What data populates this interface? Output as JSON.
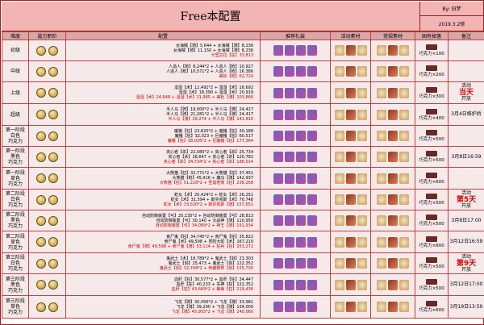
{
  "header": {
    "title": "Free本配置",
    "author": "By: 旧梦",
    "date": "2019.3.2修"
  },
  "columns": [
    "难度",
    "敌方职阶",
    "配置",
    "推荐礼装",
    "活动素材",
    "常规素材",
    "固有掉落",
    "备注"
  ],
  "rows": [
    {
      "difficulty": "初级",
      "config": [
        "女海賊【骑】5,644 + 女海賊【骑】8,236",
        "女海賊【骑】11,150 + 女海賊【骑】8,236",
        "卡里古拉【狂】33,813"
      ],
      "drop": "巧克力×100",
      "note": []
    },
    {
      "difficulty": "中级",
      "config": [
        "人造人【枪】8,244*2 + 人造人【枪】10,927",
        "人造人【枪】10,571*2 + 人造人【枪】16,386",
        "美狄【枪】62,720"
      ],
      "drop": "巧克力×200",
      "note": []
    },
    {
      "difficulty": "上级",
      "config": [
        "湿湿【术】12,492*2 + 湿湿【术】16,692",
        "湿湿【术】18,390 + 湿湿【术】20,919",
        "湿湿【术】24,648 + 湿湿【术】21,985 + 美杜【骑】103,866"
      ],
      "drop": "巧克力×300",
      "note": [
        "活动",
        "当天",
        "开放"
      ]
    },
    {
      "difficulty": "超级",
      "config": [
        "半人马【骑】19,000*2 + 半人马【骑】24,417",
        "半人马【骑】21,281*2 + 半人马【骑】24,417",
        "半人马【骑】29,274 + 半人马【骑】141,810"
      ],
      "drop": "巧克力×400",
      "note": [
        "3月4日维护后"
      ]
    },
    {
      "difficulty": "第一阶段 白色 巧克力",
      "config": [
        "魔猪【狂】23,820*2 + 魔猪【狂】30,188",
        "魔猪【狂】32,023 + 巨魔猪【狂】60,517",
        "魔猪【狂】38,026*2 + 巨魔猪【狂】177,364"
      ],
      "drop": "巧克力×500",
      "note": []
    },
    {
      "difficulty": "第一阶段 黑色 巧克力",
      "config": [
        "夹心者【杀】22,085*2 + 夹心者【杀】25,734",
        "夹心者【杀】28,647 + 夹心者【杀】120,782",
        "夹心者【杀】34,734*2 + 夹心者【杀】186,014"
      ],
      "drop": "巧克力×500",
      "note": [
        "3月8日16:59"
      ]
    },
    {
      "difficulty": "第一阶段 草色 巧克力",
      "config": [
        "大熊猫【狂】32,771*2 + 大熊猫【狂】37,451",
        "大熊猫【枪】45,916 + 魔马【骑】142,937",
        "大熊猫【狂】51,228*2 + 圣诞老熊【狂】236,268"
      ],
      "drop": "巧克力×600",
      "note": []
    },
    {
      "difficulty": "第二阶段 白色 巧克力",
      "config": [
        "蛇女【术】20,424*2 + 蛇女【术】26,251",
        "蛇女【术】31,594 + 斯芬克斯【术】70,748",
        "蛇女【术】33,530*2 + 斯芬克斯【骑】157,651"
      ],
      "drop": "巧克力×500",
      "note": [
        "活动",
        "第5天",
        "开放"
      ]
    },
    {
      "difficulty": "第二阶段 黑色 巧克力",
      "config": [
        "自动防御装置【弓】25,135*2 + 自动防御装置【弓】28,813",
        "自动防御装置【弓】30,140 + 大战神【骑】110,950",
        "自动防御装置【弓】34,089*2 + 神王【骑】191,934"
      ],
      "drop": "巧克力×500",
      "note": [
        "3月8日17:00"
      ]
    },
    {
      "difficulty": "第二阶段 草色 巧克力",
      "config": [
        "食尸鬼【狂】34,745*2 + 食尸鬼【狂】35,822",
        "食尸鬼【术】49,598 + 冒险大蛇【术】167,210",
        "食尸鬼【骑】49,598 + 食尸鬼【骑】53,114 + 狂兵【狂】253,272"
      ],
      "drop": "巧克力×600",
      "note": [
        "3月12日16:59"
      ]
    },
    {
      "difficulty": "第三阶段 白色 巧克力",
      "config": [
        "鬼武士【术】18,789*2 + 鬼武士【剑】23,303",
        "鬼武士【剑】25,473 + 鬼武士【剑】122,352",
        "鬼武士【剑】32,748*2 + 骨鹿狮鹫【剑】155,700"
      ],
      "drop": "巧克力×500",
      "note": [
        "活动",
        "第9天",
        "开放"
      ]
    },
    {
      "difficulty": "第三阶段 黑色 巧克力",
      "config": [
        "血肝【狂】30,577*2 + 血肝【狂】34,447",
        "血肝【狂】40,233 + 失神【狂】122,352",
        "血肝【狂】43,669*2 + 蒂美【狂】219,438"
      ],
      "drop": "巧克力×500",
      "note": [
        "3月12日17:00"
      ]
    },
    {
      "difficulty": "第三阶段 草色 巧克力",
      "config": [
        "飞龙【骑】30,456*2 + 飞龙【骑】33,981",
        "飞龙【骑】39,290 + 飞龙【骑】134,000",
        "飞龙【骑】45,955*2 + 飞龙【骑】240,060"
      ],
      "drop": "巧克力×600",
      "note": [
        "3月19日13:59"
      ]
    }
  ]
}
